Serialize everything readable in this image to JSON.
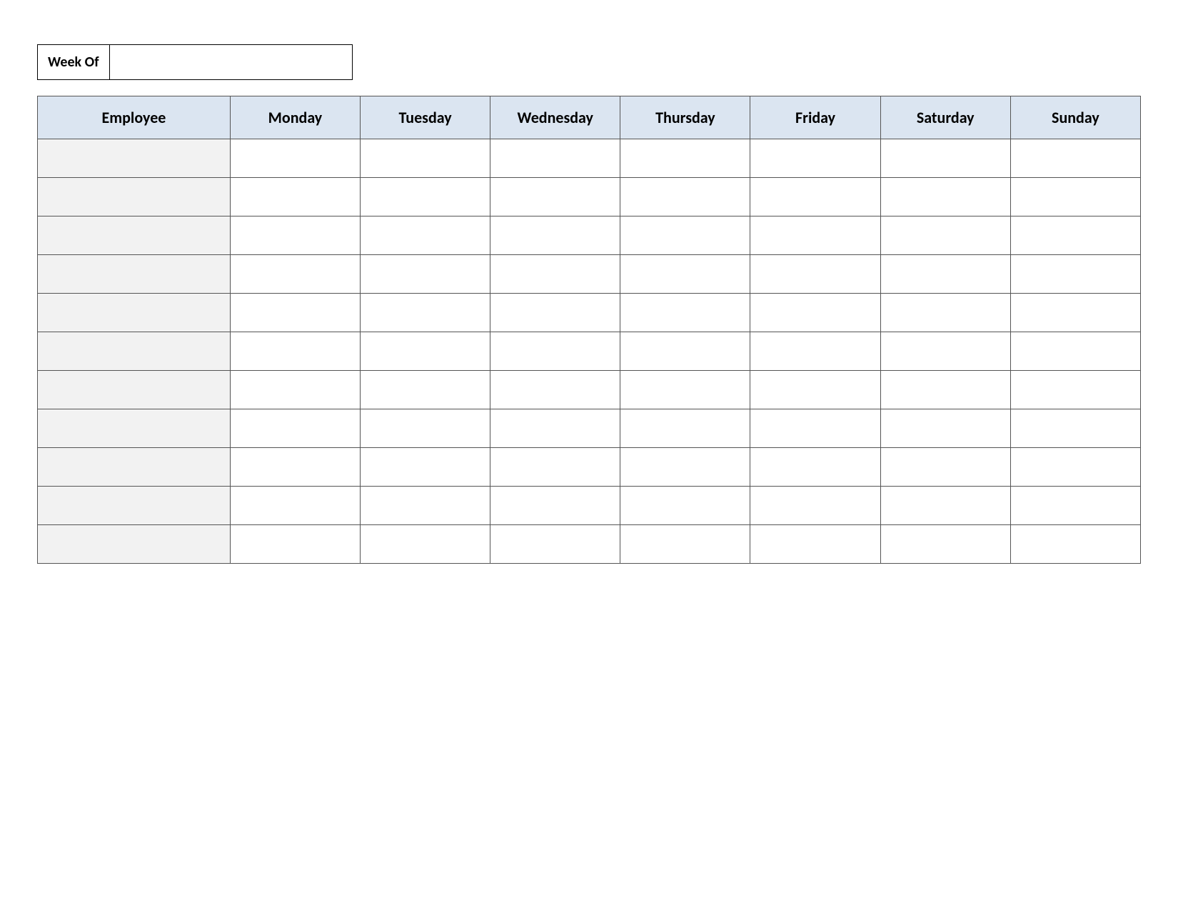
{
  "week_of": {
    "label": "Week Of",
    "value": ""
  },
  "headers": {
    "employee": "Employee",
    "days": [
      "Monday",
      "Tuesday",
      "Wednesday",
      "Thursday",
      "Friday",
      "Saturday",
      "Sunday"
    ]
  },
  "rows": [
    {
      "employee": "",
      "cells": [
        "",
        "",
        "",
        "",
        "",
        "",
        ""
      ]
    },
    {
      "employee": "",
      "cells": [
        "",
        "",
        "",
        "",
        "",
        "",
        ""
      ]
    },
    {
      "employee": "",
      "cells": [
        "",
        "",
        "",
        "",
        "",
        "",
        ""
      ]
    },
    {
      "employee": "",
      "cells": [
        "",
        "",
        "",
        "",
        "",
        "",
        ""
      ]
    },
    {
      "employee": "",
      "cells": [
        "",
        "",
        "",
        "",
        "",
        "",
        ""
      ]
    },
    {
      "employee": "",
      "cells": [
        "",
        "",
        "",
        "",
        "",
        "",
        ""
      ]
    },
    {
      "employee": "",
      "cells": [
        "",
        "",
        "",
        "",
        "",
        "",
        ""
      ]
    },
    {
      "employee": "",
      "cells": [
        "",
        "",
        "",
        "",
        "",
        "",
        ""
      ]
    },
    {
      "employee": "",
      "cells": [
        "",
        "",
        "",
        "",
        "",
        "",
        ""
      ]
    },
    {
      "employee": "",
      "cells": [
        "",
        "",
        "",
        "",
        "",
        "",
        ""
      ]
    },
    {
      "employee": "",
      "cells": [
        "",
        "",
        "",
        "",
        "",
        "",
        ""
      ]
    }
  ]
}
